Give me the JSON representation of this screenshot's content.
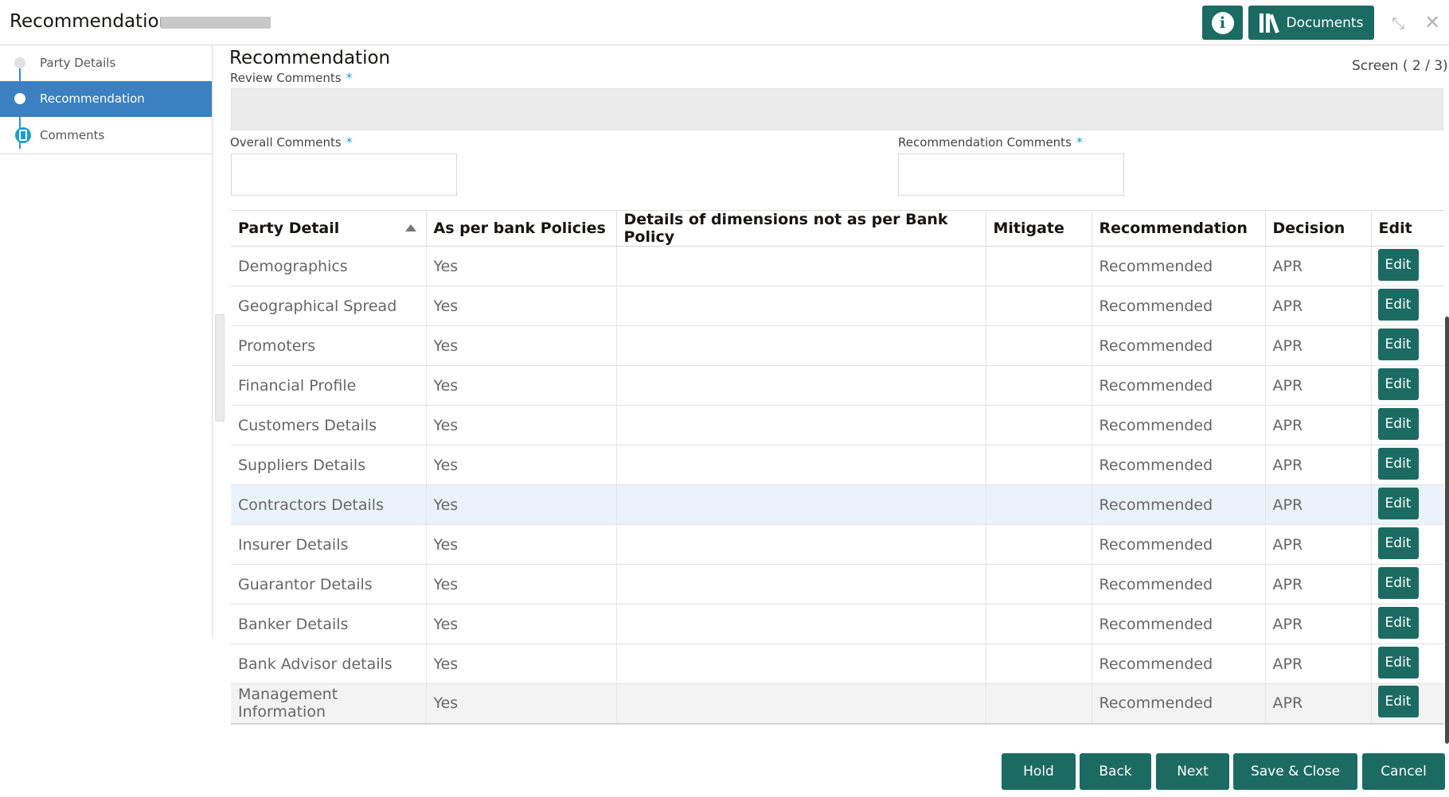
{
  "header": {
    "title": "Recommendation -",
    "documents_label": "Documents",
    "info_icon": "info-icon",
    "minimize_icon": "minimize-icon",
    "close_icon": "close-icon"
  },
  "sidebar": {
    "items": [
      {
        "label": "Party Details",
        "state": "visited"
      },
      {
        "label": "Recommendation",
        "state": "active"
      },
      {
        "label": "Comments",
        "state": "pending"
      }
    ]
  },
  "main": {
    "title": "Recommendation",
    "screen_indicator": "Screen ( 2 / 3)",
    "review_label": "Review Comments",
    "review_value": "",
    "overall_label": "Overall Comments",
    "overall_value": "",
    "recommendation_label": "Recommendation Comments",
    "recommendation_value": "",
    "required_marker": "*"
  },
  "table": {
    "columns": [
      "Party Detail",
      "As per bank Policies",
      "Details of dimensions not as per Bank Policy",
      "Mitigate",
      "Recommendation",
      "Decision",
      "Edit"
    ],
    "edit_label": "Edit",
    "rows": [
      {
        "party": "Demographics",
        "policy": "Yes",
        "details": "",
        "mitigate": "",
        "recommendation": "Recommended",
        "decision": "APR"
      },
      {
        "party": "Geographical Spread",
        "policy": "Yes",
        "details": "",
        "mitigate": "",
        "recommendation": "Recommended",
        "decision": "APR"
      },
      {
        "party": "Promoters",
        "policy": "Yes",
        "details": "",
        "mitigate": "",
        "recommendation": "Recommended",
        "decision": "APR"
      },
      {
        "party": "Financial Profile",
        "policy": "Yes",
        "details": "",
        "mitigate": "",
        "recommendation": "Recommended",
        "decision": "APR"
      },
      {
        "party": "Customers Details",
        "policy": "Yes",
        "details": "",
        "mitigate": "",
        "recommendation": "Recommended",
        "decision": "APR"
      },
      {
        "party": "Suppliers Details",
        "policy": "Yes",
        "details": "",
        "mitigate": "",
        "recommendation": "Recommended",
        "decision": "APR"
      },
      {
        "party": "Contractors Details",
        "policy": "Yes",
        "details": "",
        "mitigate": "",
        "recommendation": "Recommended",
        "decision": "APR"
      },
      {
        "party": "Insurer Details",
        "policy": "Yes",
        "details": "",
        "mitigate": "",
        "recommendation": "Recommended",
        "decision": "APR"
      },
      {
        "party": "Guarantor Details",
        "policy": "Yes",
        "details": "",
        "mitigate": "",
        "recommendation": "Recommended",
        "decision": "APR"
      },
      {
        "party": "Banker Details",
        "policy": "Yes",
        "details": "",
        "mitigate": "",
        "recommendation": "Recommended",
        "decision": "APR"
      },
      {
        "party": "Bank Advisor details",
        "policy": "Yes",
        "details": "",
        "mitigate": "",
        "recommendation": "Recommended",
        "decision": "APR"
      },
      {
        "party": "Management Information",
        "policy": "Yes",
        "details": "",
        "mitigate": "",
        "recommendation": "Recommended",
        "decision": "APR"
      }
    ]
  },
  "footer": {
    "hold": "Hold",
    "back": "Back",
    "next": "Next",
    "save_close": "Save & Close",
    "cancel": "Cancel"
  },
  "colors": {
    "primary_button": "#1c6b63",
    "active_nav": "#3b80c1",
    "required_marker": "#1b9fd4"
  }
}
